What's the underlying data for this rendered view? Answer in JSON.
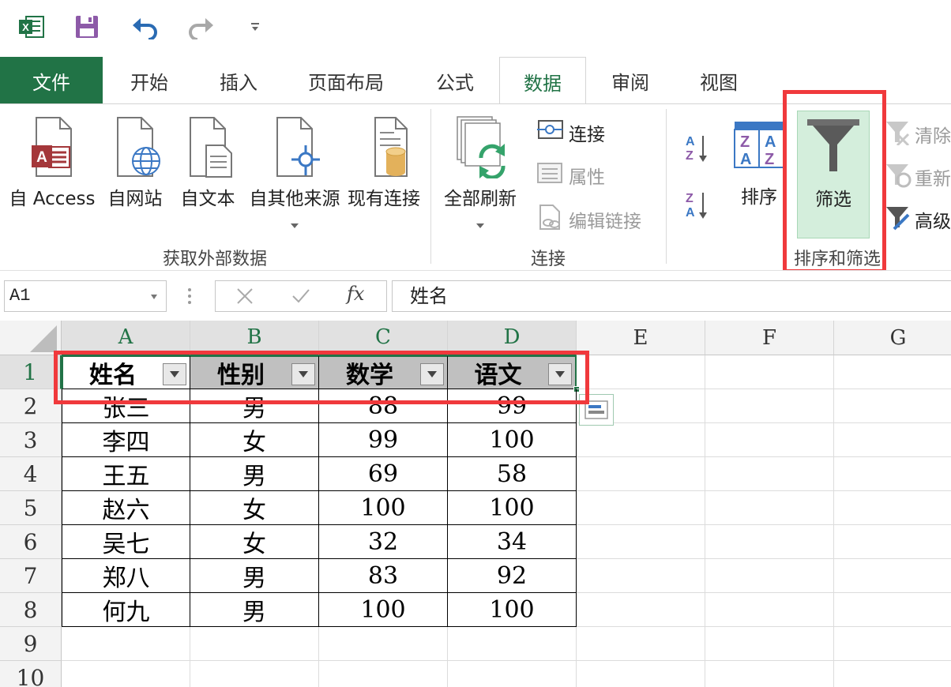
{
  "qat": {
    "excel_icon": "excel-icon",
    "save_icon": "save-icon",
    "undo_icon": "undo-icon",
    "redo_icon": "redo-icon",
    "customize_icon": "customize-dropdown-icon"
  },
  "tabs": {
    "file": "文件",
    "home": "开始",
    "insert": "插入",
    "page_layout": "页面布局",
    "formulas": "公式",
    "data": "数据",
    "review": "审阅",
    "view": "视图"
  },
  "ribbon": {
    "external": {
      "access": "自 Access",
      "web": "自网站",
      "text": "自文本",
      "other": "自其他来源",
      "existing": "现有连接",
      "group": "获取外部数据"
    },
    "connections": {
      "refresh_all": "全部刷新",
      "connections": "连接",
      "properties": "属性",
      "edit_links": "编辑链接",
      "group": "连接"
    },
    "sort_filter": {
      "sort": "排序",
      "filter": "筛选",
      "clear": "清除",
      "reapply": "重新",
      "advanced": "高级",
      "group": "排序和筛选"
    }
  },
  "formula_bar": {
    "name_box": "A1",
    "fx": "fx",
    "content": "姓名"
  },
  "grid": {
    "columns": [
      "A",
      "B",
      "C",
      "D",
      "E",
      "F",
      "G"
    ],
    "rows": [
      "1",
      "2",
      "3",
      "4",
      "5",
      "6",
      "7",
      "8",
      "9",
      "10"
    ],
    "headers": [
      "姓名",
      "性别",
      "数学",
      "语文"
    ],
    "data": [
      [
        "张三",
        "男",
        "88",
        "99"
      ],
      [
        "李四",
        "女",
        "99",
        "100"
      ],
      [
        "王五",
        "男",
        "69",
        "58"
      ],
      [
        "赵六",
        "女",
        "100",
        "100"
      ],
      [
        "吴七",
        "女",
        "32",
        "34"
      ],
      [
        "郑八",
        "男",
        "83",
        "92"
      ],
      [
        "何九",
        "男",
        "100",
        "100"
      ]
    ]
  },
  "colors": {
    "accent": "#217346",
    "highlight": "#f0393c",
    "filter_active_bg": "#d4eedc"
  }
}
